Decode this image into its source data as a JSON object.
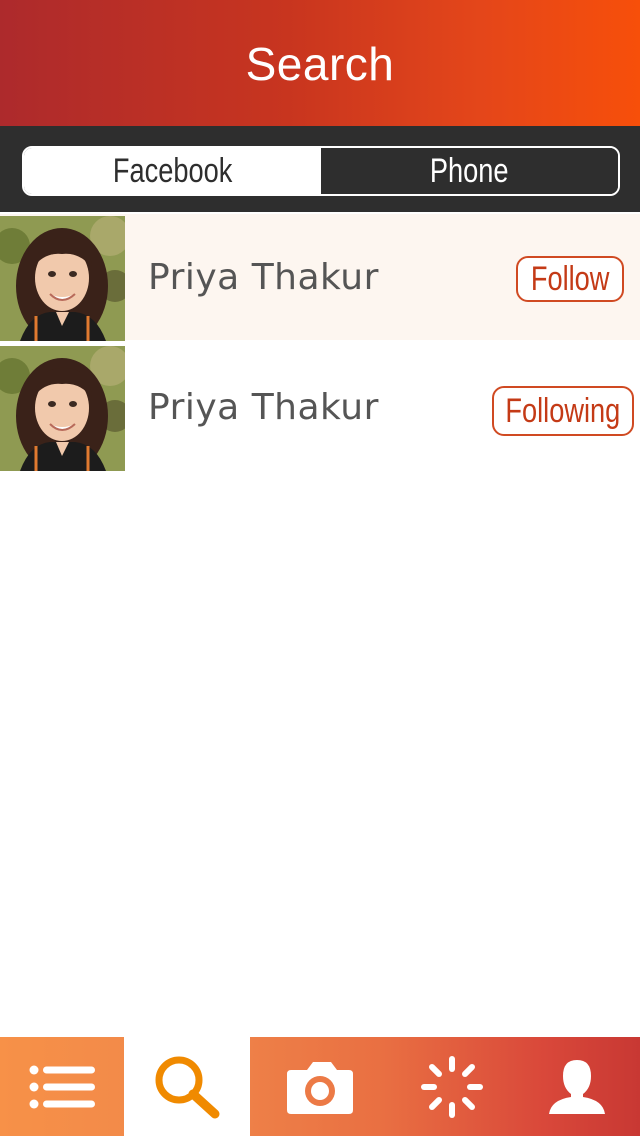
{
  "header": {
    "title": "Search"
  },
  "segments": [
    {
      "label": "Facebook",
      "selected": false
    },
    {
      "label": "Phone",
      "selected": true
    }
  ],
  "results": [
    {
      "name": "Priya Thakur",
      "action": "Follow",
      "highlighted": true
    },
    {
      "name": "Priya Thakur",
      "action": "Following",
      "highlighted": false
    }
  ],
  "tabbar": {
    "items": [
      {
        "icon": "list-icon",
        "selected": false
      },
      {
        "icon": "search-icon",
        "selected": true
      },
      {
        "icon": "camera-icon",
        "selected": false
      },
      {
        "icon": "activity-spinner-icon",
        "selected": false
      },
      {
        "icon": "profile-icon",
        "selected": false
      }
    ]
  },
  "colors": {
    "header_start": "#ad2a2c",
    "header_end": "#f74f0a",
    "segment_dark": "#2e2e2e",
    "accent": "#c43a16",
    "tab_selected_icon": "#f08a00"
  }
}
